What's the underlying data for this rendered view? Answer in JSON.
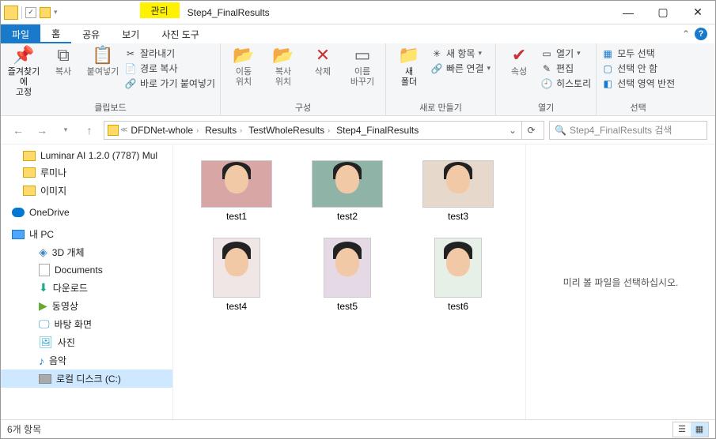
{
  "title": {
    "context_tab": "관리",
    "context_sub": "사진 도구",
    "window_title": "Step4_FinalResults"
  },
  "tabs": {
    "file": "파일",
    "home": "홈",
    "share": "공유",
    "view": "보기"
  },
  "ribbon": {
    "clipboard": {
      "pin": "즐겨찾기에\n고정",
      "copy": "복사",
      "paste": "붙여넣기",
      "cut": "잘라내기",
      "copy_path": "경로 복사",
      "paste_shortcut": "바로 가기 붙여넣기",
      "label": "클립보드"
    },
    "organize": {
      "move_to": "이동\n위치",
      "copy_to": "복사\n위치",
      "delete": "삭제",
      "rename": "이름\n바꾸기",
      "label": "구성"
    },
    "new": {
      "new_folder": "새\n폴더",
      "new_item": "새 항목",
      "easy_access": "빠른 연결",
      "label": "새로 만들기"
    },
    "open": {
      "properties": "속성",
      "open": "열기",
      "edit": "편집",
      "history": "히스토리",
      "label": "열기"
    },
    "select": {
      "select_all": "모두 선택",
      "select_none": "선택 안 함",
      "invert": "선택 영역 반전",
      "label": "선택"
    }
  },
  "breadcrumb": {
    "items": [
      "DFDNet-whole",
      "Results",
      "TestWholeResults",
      "Step4_FinalResults"
    ]
  },
  "search": {
    "placeholder": "Step4_FinalResults 검색"
  },
  "sidebar": {
    "items": [
      {
        "label": "Luminar AI 1.2.0 (7787) Mul",
        "icon": "folder"
      },
      {
        "label": "루미나",
        "icon": "folder"
      },
      {
        "label": "이미지",
        "icon": "folder"
      },
      {
        "label": "OneDrive",
        "icon": "onedrive",
        "category": true
      },
      {
        "label": "내 PC",
        "icon": "pc",
        "category": true
      },
      {
        "label": "3D 개체",
        "icon": "3d",
        "indent": true
      },
      {
        "label": "Documents",
        "icon": "doc",
        "indent": true
      },
      {
        "label": "다운로드",
        "icon": "dl",
        "indent": true
      },
      {
        "label": "동영상",
        "icon": "vid",
        "indent": true
      },
      {
        "label": "바탕 화면",
        "icon": "desk",
        "indent": true
      },
      {
        "label": "사진",
        "icon": "pic",
        "indent": true
      },
      {
        "label": "음악",
        "icon": "music",
        "indent": true
      },
      {
        "label": "로컬 디스크 (C:)",
        "icon": "disk",
        "indent": true,
        "selected": true
      }
    ]
  },
  "files": {
    "items": [
      {
        "name": "test1",
        "orientation": "landscape",
        "bg": "#d9a6a6"
      },
      {
        "name": "test2",
        "orientation": "landscape",
        "bg": "#8fb3a6"
      },
      {
        "name": "test3",
        "orientation": "landscape",
        "bg": "#e6d9cc"
      },
      {
        "name": "test4",
        "orientation": "portrait",
        "bg": "#f0e6e6"
      },
      {
        "name": "test5",
        "orientation": "portrait",
        "bg": "#e6d9e6"
      },
      {
        "name": "test6",
        "orientation": "portrait",
        "bg": "#e6f0e6"
      }
    ]
  },
  "preview": {
    "empty_text": "미리 볼 파일을 선택하십시오."
  },
  "status": {
    "count": "6개 항목"
  }
}
